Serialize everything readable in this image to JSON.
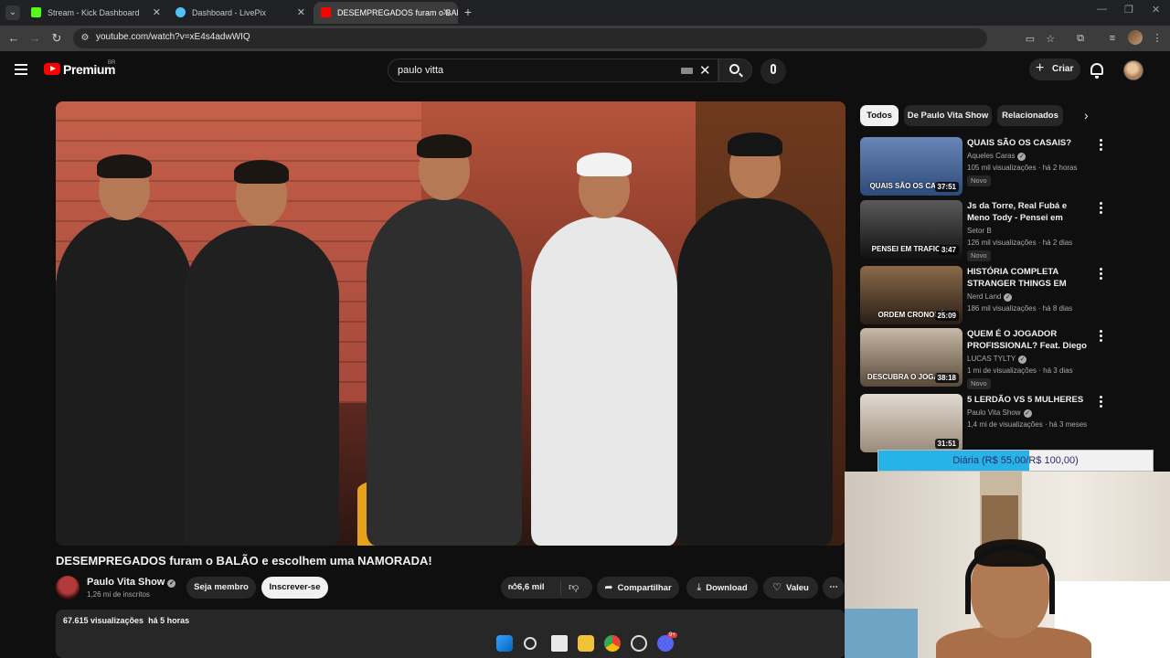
{
  "browser": {
    "tabs": [
      {
        "title": "Stream - Kick Dashboard",
        "favicon_color": "#53fc18",
        "active": false
      },
      {
        "title": "Dashboard - LivePix",
        "favicon_color": "#4fc3f7",
        "active": false
      },
      {
        "title": "DESEMPREGADOS furam o BAL...",
        "favicon_color": "#ff0000",
        "active": true
      }
    ],
    "url": "youtube.com/watch?v=xE4s4adwWIQ",
    "new_tab_icon": "plus-icon"
  },
  "youtube": {
    "brand": "Premium",
    "country": "BR",
    "search_query": "paulo vitta",
    "create_label": "Criar",
    "video": {
      "title": "DESEMPREGADOS furam o BALÃO e escolhem uma NAMORADA!",
      "channel": "Paulo Vita Show",
      "subscribers": "1,26 mi de inscritos",
      "member_label": "Seja membro",
      "subscribe_label": "Inscrever-se",
      "likes": "6,6 mil",
      "share_label": "Compartilhar",
      "download_label": "Download",
      "thanks_label": "Valeu",
      "views": "67.615 visualizações",
      "age": "há 5 horas"
    },
    "chips": [
      "Todos",
      "De Paulo Vita Show",
      "Relacionados"
    ],
    "recommendations": [
      {
        "title": "QUAIS SÃO OS CASAIS?",
        "channel": "Aqueles Caras",
        "views": "105 mil visualizações",
        "age": "há 2 horas",
        "duration": "37:51",
        "badge": "Novo",
        "thumb_caption": "QUAIS SÃO OS CASAIS",
        "thumb_color": "#4a6fa5"
      },
      {
        "title": "Js da Torre, Real Fubá e Meno Tody - Pensei em traficar",
        "channel": "Setor B",
        "views": "126 mil visualizações",
        "age": "há 2 dias",
        "duration": "3:47",
        "badge": "Novo",
        "thumb_caption": "PENSEI EM TRAFICAR",
        "thumb_color": "#3a3a3a"
      },
      {
        "title": "HISTÓRIA COMPLETA STRANGER THINGS EM ORDE...",
        "channel": "Nerd Land",
        "views": "186 mil visualizações",
        "age": "há 8 dias",
        "duration": "25:09",
        "badge": "",
        "thumb_caption": "ORDEM CRONOLÓ",
        "thumb_color": "#5a4a3a"
      },
      {
        "title": "QUEM É O JOGADOR PROFISSIONAL? Feat. Diego ...",
        "channel": "LUCAS TYLTY",
        "views": "1 mi de visualizações",
        "age": "há 3 dias",
        "duration": "38:18",
        "badge": "Novo",
        "thumb_caption": "DESCUBRA O JOGADOR",
        "thumb_color": "#7a6a5a"
      },
      {
        "title": "5 LERDÃO VS 5 MULHERES",
        "channel": "Paulo Vita Show",
        "views": "1,4 mi de visualizações",
        "age": "há 3 meses",
        "duration": "31:51",
        "badge": "",
        "thumb_caption": "",
        "thumb_color": "#d8d0c8"
      }
    ]
  },
  "overlay": {
    "goal_text": "Diária (R$ 55,00/R$ 100,00)",
    "goal_progress": 0.55,
    "goal_color": "#27b3e8"
  },
  "taskbar": {
    "icons": [
      "windows-start-icon",
      "search-icon",
      "task-view-icon",
      "file-explorer-icon",
      "chrome-icon",
      "obs-icon",
      "discord-icon"
    ],
    "discord_badge": "9+"
  }
}
